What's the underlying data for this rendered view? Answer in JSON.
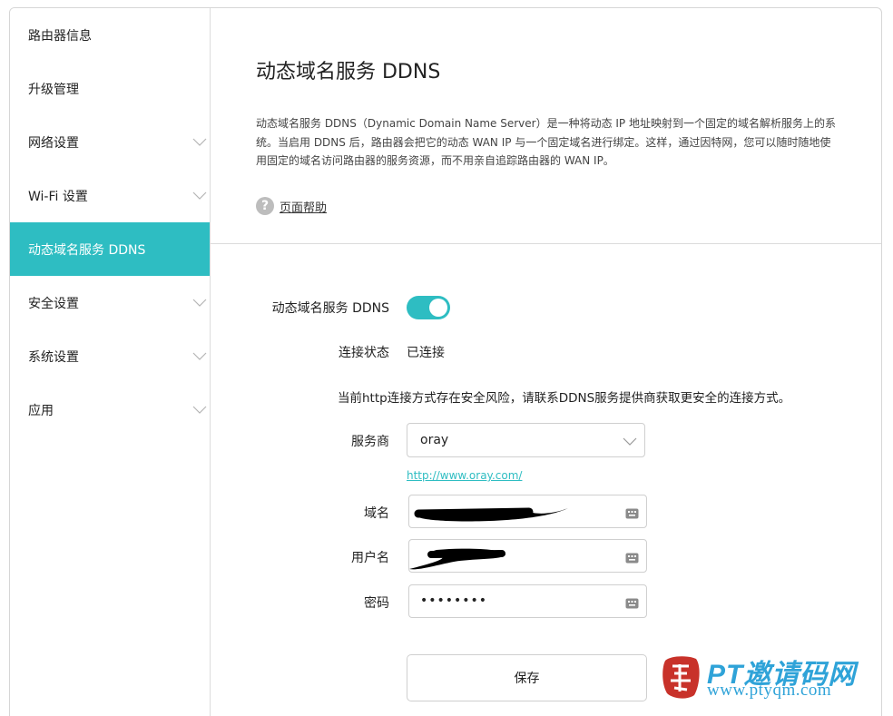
{
  "sidebar": {
    "items": [
      {
        "label": "路由器信息",
        "has_chevron": false,
        "active": false
      },
      {
        "label": "升级管理",
        "has_chevron": false,
        "active": false
      },
      {
        "label": "网络设置",
        "has_chevron": true,
        "active": false
      },
      {
        "label": "Wi-Fi 设置",
        "has_chevron": true,
        "active": false
      },
      {
        "label": "动态域名服务 DDNS",
        "has_chevron": false,
        "active": true
      },
      {
        "label": "安全设置",
        "has_chevron": true,
        "active": false
      },
      {
        "label": "系统设置",
        "has_chevron": true,
        "active": false
      },
      {
        "label": "应用",
        "has_chevron": true,
        "active": false
      }
    ]
  },
  "main": {
    "title": "动态域名服务 DDNS",
    "description": "动态域名服务 DDNS（Dynamic Domain Name Server）是一种将动态 IP 地址映射到一个固定的域名解析服务上的系统。当启用 DDNS 后，路由器会把它的动态 WAN IP 与一个固定域名进行绑定。这样，通过因特网，您可以随时随地使用固定的域名访问路由器的服务资源，而不用亲自追踪路由器的 WAN IP。",
    "help_label": "页面帮助",
    "help_icon": "question-circle-icon"
  },
  "form": {
    "ddns_label": "动态域名服务 DDNS",
    "ddns_enabled": true,
    "status_label": "连接状态",
    "status_value": "已连接",
    "warning": "当前http连接方式存在安全风险，请联系DDNS服务提供商获取更安全的连接方式。",
    "provider_label": "服务商",
    "provider_value": "oray",
    "provider_link": "http://www.oray.com/",
    "domain_label": "域名",
    "domain_value": "",
    "username_label": "用户名",
    "username_value": "",
    "password_label": "密码",
    "password_value": "••••••••",
    "save_label": "保存"
  },
  "watermark": {
    "title": "PT邀请码网",
    "url": "www.ptyqm.com"
  },
  "colors": {
    "accent": "#2ebdc2",
    "watermark": "#2fa3d8",
    "watermark_logo": "#c8322a"
  }
}
